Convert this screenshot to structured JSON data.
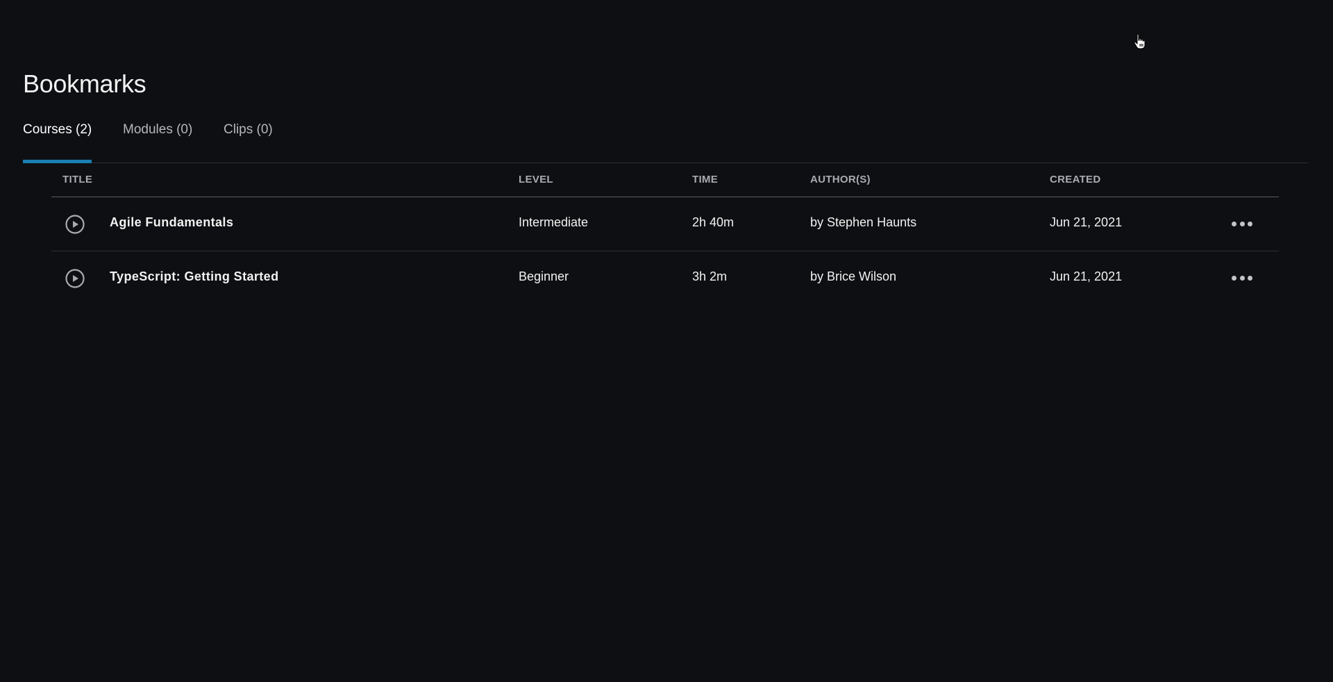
{
  "page": {
    "title": "Bookmarks"
  },
  "tabs": [
    {
      "label": "Courses (2)",
      "active": true
    },
    {
      "label": "Modules (0)",
      "active": false
    },
    {
      "label": "Clips (0)",
      "active": false
    }
  ],
  "colors": {
    "accent": "#1a7fb3",
    "background": "#0e0f12"
  },
  "table": {
    "columns": [
      "TITLE",
      "LEVEL",
      "TIME",
      "AUTHOR(S)",
      "CREATED"
    ],
    "rows": [
      {
        "title": "Agile Fundamentals",
        "level": "Intermediate",
        "time": "2h 40m",
        "authors": "by Stephen Haunts",
        "created": "Jun 21, 2021",
        "play_icon": "play-circle-icon",
        "more_icon": "more-horizontal-icon"
      },
      {
        "title": "TypeScript: Getting Started",
        "level": "Beginner",
        "time": "3h 2m",
        "authors": "by Brice Wilson",
        "created": "Jun 21, 2021",
        "play_icon": "play-circle-icon",
        "more_icon": "more-horizontal-icon"
      }
    ]
  },
  "cursor": {
    "icon": "hand-pointer-icon"
  }
}
